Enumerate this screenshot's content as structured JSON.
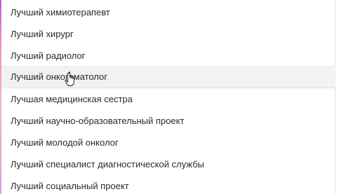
{
  "dropdown": {
    "options": [
      {
        "label": "Лучший химиотерапевт"
      },
      {
        "label": "Лучший хирург"
      },
      {
        "label": "Лучший радиолог"
      },
      {
        "label": "Лучший онкогематолог",
        "hovered": true
      },
      {
        "label": "Лучшая медицинская сестра"
      },
      {
        "label": "Лучший научно-образовательный проект"
      },
      {
        "label": "Лучший молодой онколог"
      },
      {
        "label": "Лучший специалист диагностической службы"
      },
      {
        "label": "Лучший социальный проект"
      }
    ]
  },
  "cursor": {
    "icon": "hand-pointer-icon"
  },
  "colors": {
    "text": "#2b2b2b",
    "hover_background": "#f2f2f4",
    "accent_edge": "#ef8cc0"
  }
}
